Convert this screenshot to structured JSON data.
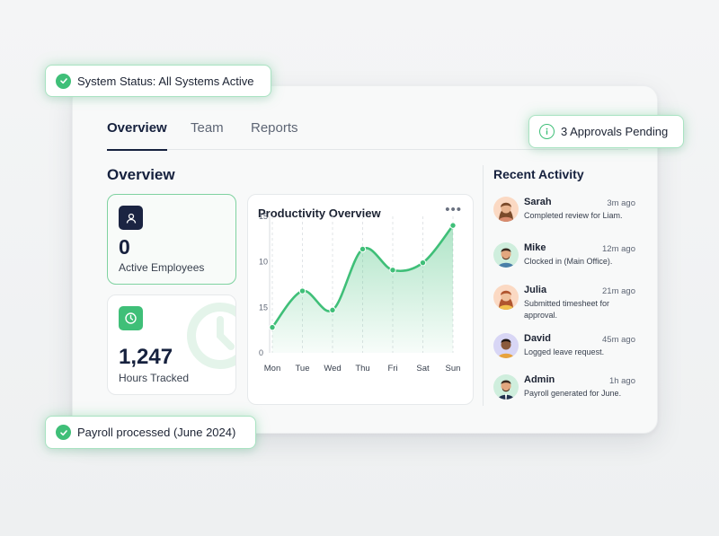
{
  "tabs": [
    {
      "label": "Overview",
      "active": true
    },
    {
      "label": "Team",
      "active": false
    },
    {
      "label": "Reports",
      "active": false
    }
  ],
  "section_title": "Overview",
  "stats": {
    "active_employees": {
      "value": "0",
      "label": "Active Employees",
      "icon": "user-icon"
    },
    "hours_tracked": {
      "value": "1,247",
      "label": "Hours Tracked",
      "icon": "clock-icon"
    }
  },
  "chart": {
    "title": "Productivity Overview",
    "menu_icon": "more-dots-icon"
  },
  "chart_data": {
    "type": "area",
    "title": "Productivity Overview",
    "categories": [
      "Mon",
      "Tue",
      "Wed",
      "Thu",
      "Fri",
      "Sat",
      "Sun"
    ],
    "values": [
      2.8,
      6.8,
      4.7,
      11.4,
      9.1,
      9.9,
      14.0
    ],
    "ylim": [
      0,
      15
    ],
    "yticks": [
      "15",
      "10",
      "15",
      "0"
    ],
    "grid": "vertical dashed",
    "color": "#3fbf78"
  },
  "recent": {
    "title": "Recent Activity",
    "items": [
      {
        "name": "Sarah",
        "time": "3m ago",
        "message": "Completed review for Liam."
      },
      {
        "name": "Mike",
        "time": "12m ago",
        "message": "Clocked in (Main Office)."
      },
      {
        "name": "Julia",
        "time": "21m ago",
        "message": "Submitted timesheet for approval."
      },
      {
        "name": "David",
        "time": "45m ago",
        "message": "Logged leave request."
      },
      {
        "name": "Admin",
        "time": "1h ago",
        "message": "Payroll generated for June."
      }
    ]
  },
  "badges": {
    "system_status": "System Status: All Systems Active",
    "approvals": "3 Approvals Pending",
    "payroll": "Payroll processed (June 2024)"
  },
  "colors": {
    "accent": "#3fbf78",
    "navy": "#1b2442"
  }
}
